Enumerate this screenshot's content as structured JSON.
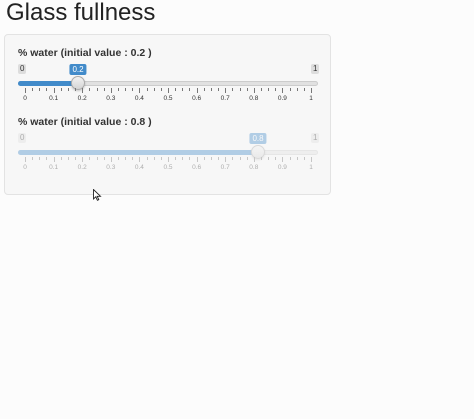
{
  "page": {
    "title": "Glass fullness"
  },
  "sliders": [
    {
      "label": "% water (initial value : 0.2 )",
      "min": 0,
      "max": 1,
      "value": 0.2,
      "min_label": "0",
      "max_label": "1",
      "value_label": "0.2",
      "enabled": true,
      "tick_labels": [
        "0",
        "0.1",
        "0.2",
        "0.3",
        "0.4",
        "0.5",
        "0.6",
        "0.7",
        "0.8",
        "0.9",
        "1"
      ]
    },
    {
      "label": "% water (initial value : 0.8 )",
      "min": 0,
      "max": 1,
      "value": 0.8,
      "min_label": "0",
      "max_label": "1",
      "value_label": "0.8",
      "enabled": false,
      "tick_labels": [
        "0",
        "0.1",
        "0.2",
        "0.3",
        "0.4",
        "0.5",
        "0.6",
        "0.7",
        "0.8",
        "0.9",
        "1"
      ]
    }
  ],
  "colors": {
    "accent": "#428bca",
    "track": "#e1e1e1"
  },
  "icons": {
    "cursor": "mouse-pointer-icon"
  }
}
